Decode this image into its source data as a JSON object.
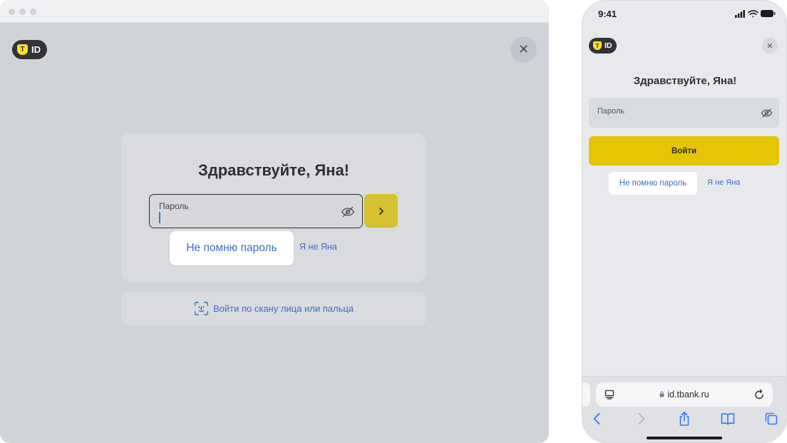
{
  "colors": {
    "accent_yellow": "#ffdd2d",
    "button_yellow": "#e5c607",
    "link_blue": "#3d6fc4",
    "overlay_gray": "#d0d3d8"
  },
  "desktop": {
    "logo_text": "ID",
    "logo_badge": "T",
    "close_glyph": "✕",
    "title": "Здравствуйте, Яна!",
    "password_label": "Пароль",
    "next_icon": "chevron-right-icon",
    "forgot_label": "Не помню пароль",
    "not_me_label": "Я не Яна",
    "scan_label": "Войти по скану лица или пальца"
  },
  "mobile": {
    "time": "9:41",
    "logo_text": "ID",
    "logo_badge": "T",
    "close_glyph": "✕",
    "title": "Здравствуйте, Яна!",
    "password_label": "Пароль",
    "submit_label": "Войти",
    "forgot_label": "Не помню пароль",
    "not_me_label": "Я не Яна",
    "url": "id.tbank.ru"
  }
}
